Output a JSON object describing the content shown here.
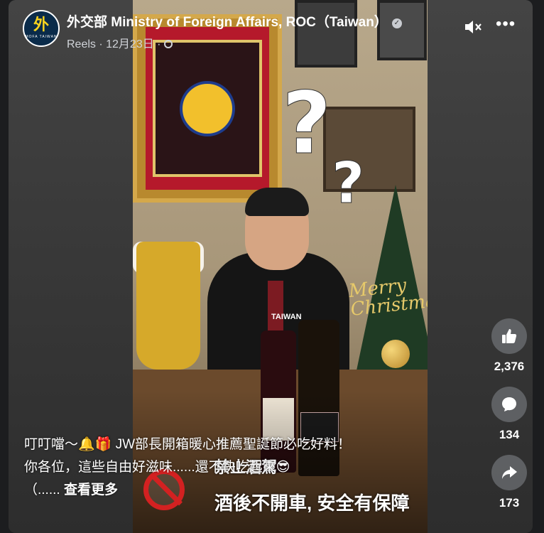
{
  "header": {
    "page_name": "外交部 Ministry of Foreign Affairs, ROC（Taiwan）",
    "meta": "Reels · 12月23日 ·",
    "avatar_glyph": "外",
    "avatar_sub": "MOFA TAIWAN",
    "more_label": "•••"
  },
  "video": {
    "frame_text": "Merry Christmas",
    "badge_text": "TAIWAN",
    "overlay_line1": "禁止酒駕",
    "overlay_line2": "酒後不開車, 安全有保障"
  },
  "caption": {
    "line1": "叮叮噹～🔔🎁 JW部長開箱暖心推薦聖誕節必吃好料！",
    "line2": "你各位，這些自由好滋味......還不快吃起來😎",
    "line3_prefix": "（......",
    "see_more": "查看更多"
  },
  "actions": {
    "like_count": "2,376",
    "comment_count": "134",
    "share_count": "173"
  },
  "colors": {
    "background": "#1c1d1f",
    "accent_red": "#d32121",
    "avatar_yellow": "#f7d21e"
  }
}
